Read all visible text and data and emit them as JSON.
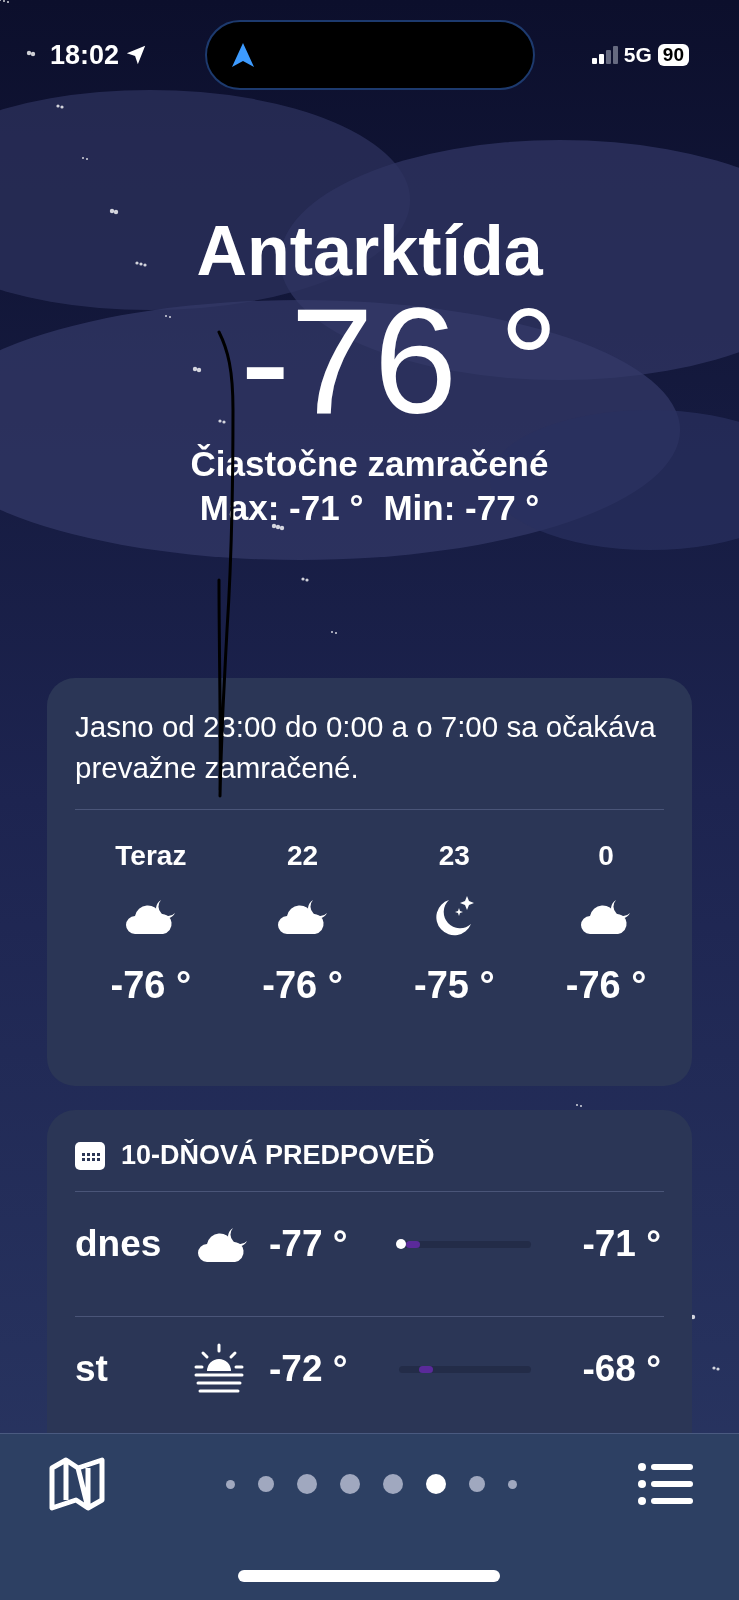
{
  "status_bar": {
    "time": "18:02",
    "network": "5G",
    "battery": "90"
  },
  "header": {
    "city": "Antarktída",
    "temperature": "-76 °",
    "condition": "Čiastočne zamračené",
    "max": "Max: -71 °",
    "min": "Min: -77 °"
  },
  "hourly": {
    "summary": "Jasno od 23:00 do 0:00 a o 7:00 sa očakáva prevažne zamračené.",
    "hours": [
      {
        "time": "Teraz",
        "kind": "cloud-moon",
        "temp": "-76 °"
      },
      {
        "time": "22",
        "kind": "cloud-moon",
        "temp": "-76 °"
      },
      {
        "time": "23",
        "kind": "moon-stars",
        "temp": "-75 °"
      },
      {
        "time": "0",
        "kind": "cloud-moon",
        "temp": "-76 °"
      }
    ]
  },
  "daily": {
    "title": "10-DŇOVÁ PREDPOVEĎ",
    "days": [
      {
        "day": "dnes",
        "kind": "cloud-moon",
        "low": "-77 °",
        "high": "-71 °",
        "level": 0.05,
        "now_marker": true
      },
      {
        "day": "st",
        "kind": "sunrise",
        "low": "-72 °",
        "high": "-68 °",
        "level": 0.15,
        "now_marker": false
      }
    ]
  },
  "page_dots": [
    {
      "kind": "small",
      "selected": false
    },
    {
      "kind": "normal",
      "selected": false
    },
    {
      "kind": "large",
      "selected": false
    },
    {
      "kind": "large",
      "selected": false
    },
    {
      "kind": "large",
      "selected": false
    },
    {
      "kind": "large",
      "selected": true
    },
    {
      "kind": "normal",
      "selected": false
    },
    {
      "kind": "small",
      "selected": false
    }
  ]
}
